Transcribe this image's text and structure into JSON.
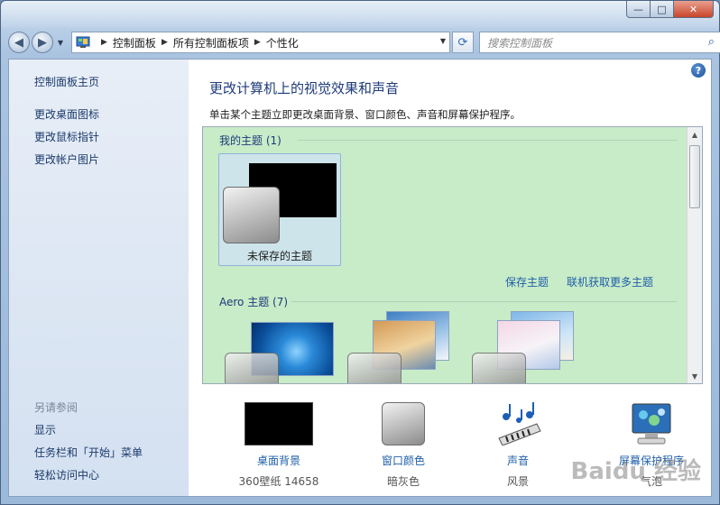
{
  "window": {
    "caption_buttons": {
      "minimize": "—",
      "maximize": "□",
      "close": "✕"
    }
  },
  "nav": {
    "back_icon": "◀",
    "forward_icon": "▶",
    "breadcrumb": [
      "控制面板",
      "所有控制面板项",
      "个性化"
    ],
    "refresh_icon": "⟳",
    "search_placeholder": "搜索控制面板",
    "search_icon": "⌕"
  },
  "sidebar": {
    "home": "控制面板主页",
    "links": [
      "更改桌面图标",
      "更改鼠标指针",
      "更改帐户图片"
    ],
    "see_also_title": "另请参阅",
    "see_also": [
      "显示",
      "任务栏和「开始」菜单",
      "轻松访问中心"
    ]
  },
  "main": {
    "help_icon": "?",
    "heading": "更改计算机上的视觉效果和声音",
    "description": "单击某个主题立即更改桌面背景、窗口颜色、声音和屏幕保护程序。",
    "my_themes_title": "我的主题 (1)",
    "unsaved_theme_label": "未保存的主题",
    "save_theme_link": "保存主题",
    "get_more_link": "联机获取更多主题",
    "aero_title": "Aero 主题 (7)",
    "pane_bg_color": "#c8ebc8"
  },
  "bottom": {
    "items": [
      {
        "label": "桌面背景",
        "sub": "360壁纸 14658"
      },
      {
        "label": "窗口颜色",
        "sub": "暗灰色"
      },
      {
        "label": "声音",
        "sub": "风景"
      },
      {
        "label": "屏幕保护程序",
        "sub": "气泡"
      }
    ]
  },
  "watermark": "Baidu 经验"
}
